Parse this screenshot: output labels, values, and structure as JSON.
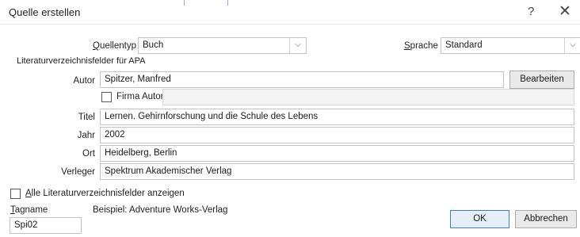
{
  "dialog": {
    "title": "Quelle erstellen",
    "help_glyph": "?",
    "close_glyph": "✕"
  },
  "source_type": {
    "label_ul": "Q",
    "label_rest": "uellentyp",
    "value": "Buch"
  },
  "language": {
    "label_ul": "S",
    "label_rest": "prache",
    "value": "Standard"
  },
  "section_label": "Literaturverzeichnisfelder für APA",
  "fields": {
    "author_label": "Autor",
    "author_value": "Spitzer, Manfred",
    "edit_button": "Bearbeiten",
    "corporate_author_label": "Firma Autor",
    "corporate_author_value": "",
    "title_label": "Titel",
    "title_value": "Lernen. Gehirnforschung und die Schule des Lebens",
    "year_label": "Jahr",
    "year_value": "2002",
    "city_label": "Ort",
    "city_value": "Heidelberg, Berlin",
    "publisher_label": "Verleger",
    "publisher_value": "Spektrum Akademischer Verlag"
  },
  "show_all": {
    "label_ul": "A",
    "label_rest": "lle Literaturverzeichnisfelder anzeigen"
  },
  "tag": {
    "label_ul": "T",
    "label_rest": "agname",
    "example": "Beispiel: Adventure Works-Verlag",
    "value": "Spi02"
  },
  "buttons": {
    "ok": "OK",
    "cancel": "Abbrechen"
  },
  "icons": {
    "dropdown": "chevron-down-icon",
    "close": "close-icon",
    "help": "help-icon"
  }
}
